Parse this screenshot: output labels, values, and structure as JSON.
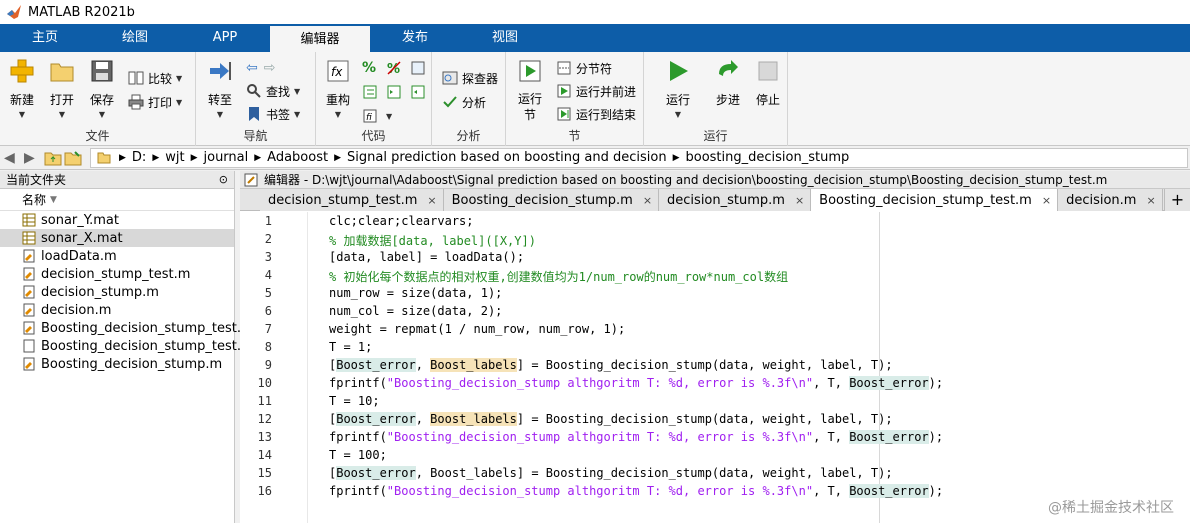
{
  "window": {
    "title": "MATLAB R2021b"
  },
  "ribbon_tabs": [
    "主页",
    "绘图",
    "APP",
    "编辑器",
    "发布",
    "视图"
  ],
  "ribbon": {
    "file": {
      "new": "新建",
      "open": "打开",
      "save": "保存",
      "compare": "比较",
      "print": "打印",
      "group": "文件"
    },
    "nav": {
      "goto": "转至",
      "find": "查找",
      "bookmark": "书签",
      "group": "导航"
    },
    "code": {
      "refactor": "重构",
      "percent": "%",
      "group": "代码"
    },
    "analyze": {
      "profiler": "探查器",
      "analyze": "分析",
      "group": "分析"
    },
    "section": {
      "run_section": "运行节",
      "section_break": "分节符",
      "run_advance": "运行并前进",
      "run_to_end": "运行到结束",
      "group": "节"
    },
    "run": {
      "run": "运行",
      "step": "步进",
      "stop": "停止",
      "group": "运行"
    }
  },
  "breadcrumb": [
    "D:",
    "wjt",
    "journal",
    "Adaboost",
    "Signal prediction based on boosting and decision",
    "boosting_decision_stump"
  ],
  "left_panel": {
    "title": "当前文件夹",
    "column": "名称",
    "files": [
      {
        "name": "sonar_Y.mat",
        "type": "mat",
        "selected": false
      },
      {
        "name": "sonar_X.mat",
        "type": "mat",
        "selected": true
      },
      {
        "name": "loadData.m",
        "type": "m",
        "selected": false
      },
      {
        "name": "decision_stump_test.m",
        "type": "m",
        "selected": false
      },
      {
        "name": "decision_stump.m",
        "type": "m",
        "selected": false
      },
      {
        "name": "decision.m",
        "type": "m",
        "selected": false
      },
      {
        "name": "Boosting_decision_stump_test.m",
        "type": "m",
        "selected": false
      },
      {
        "name": "Boosting_decision_stump_test.a...",
        "type": "doc",
        "selected": false
      },
      {
        "name": "Boosting_decision_stump.m",
        "type": "m",
        "selected": false
      }
    ]
  },
  "editor": {
    "title": "编辑器 - D:\\wjt\\journal\\Adaboost\\Signal prediction based on boosting and decision\\boosting_decision_stump\\Boosting_decision_stump_test.m",
    "tabs": [
      {
        "label": "decision_stump_test.m",
        "active": false
      },
      {
        "label": "Boosting_decision_stump.m",
        "active": false
      },
      {
        "label": "decision_stump.m",
        "active": false
      },
      {
        "label": "Boosting_decision_stump_test.m",
        "active": true
      },
      {
        "label": "decision.m",
        "active": false
      }
    ],
    "close_glyph": "×",
    "add_tab": "+",
    "lines": [
      {
        "n": "1",
        "segs": [
          [
            "",
            "clc;clear;clearvars;"
          ]
        ]
      },
      {
        "n": "2",
        "segs": [
          [
            "cm",
            "% 加载数据[data, label]([X,Y])"
          ]
        ]
      },
      {
        "n": "3",
        "segs": [
          [
            "",
            "[data, label] = loadData();"
          ]
        ]
      },
      {
        "n": "4",
        "segs": [
          [
            "cm",
            "% 初始化每个数据点的相对权重,创建数值均为1/num_row的num_row*num_col数组"
          ]
        ]
      },
      {
        "n": "5",
        "segs": [
          [
            "",
            "num_row = size(data, 1);"
          ]
        ]
      },
      {
        "n": "6",
        "segs": [
          [
            "",
            "num_col = size(data, 2);"
          ]
        ]
      },
      {
        "n": "7",
        "segs": [
          [
            "",
            "weight = repmat(1 / num_row, num_row, 1);"
          ]
        ]
      },
      {
        "n": "8",
        "segs": [
          [
            "",
            "T = 1;"
          ]
        ]
      },
      {
        "n": "9",
        "segs": [
          [
            "",
            "["
          ],
          [
            "hl-c",
            "Boost_error"
          ],
          [
            "",
            ", "
          ],
          [
            "hl-y",
            "Boost_labels"
          ],
          [
            "",
            "] = Boosting_decision_stump(data, weight, label, T);"
          ]
        ]
      },
      {
        "n": "10",
        "segs": [
          [
            "",
            "fprintf("
          ],
          [
            "str",
            "\"Boosting_decision_stump althgoritm T: %d, error is %.3f\\n\""
          ],
          [
            "",
            ", T, "
          ],
          [
            "hl-c",
            "Boost_error"
          ],
          [
            "",
            ");"
          ]
        ]
      },
      {
        "n": "11",
        "segs": [
          [
            "",
            "T = 10;"
          ]
        ]
      },
      {
        "n": "12",
        "segs": [
          [
            "",
            "["
          ],
          [
            "hl-c",
            "Boost_error"
          ],
          [
            "",
            ", "
          ],
          [
            "hl-y",
            "Boost_labels"
          ],
          [
            "",
            "] = Boosting_decision_stump(data, weight, label, T);"
          ]
        ]
      },
      {
        "n": "13",
        "segs": [
          [
            "",
            "fprintf("
          ],
          [
            "str",
            "\"Boosting_decision_stump althgoritm T: %d, error is %.3f\\n\""
          ],
          [
            "",
            ", T, "
          ],
          [
            "hl-c",
            "Boost_error"
          ],
          [
            "",
            ");"
          ]
        ]
      },
      {
        "n": "14",
        "segs": [
          [
            "",
            "T = 100;"
          ]
        ]
      },
      {
        "n": "15",
        "segs": [
          [
            "",
            "["
          ],
          [
            "hl-c",
            "Boost_error"
          ],
          [
            "",
            ", Boost_labels] = Boosting_decision_stump(data, weight, label, T);"
          ]
        ]
      },
      {
        "n": "16",
        "segs": [
          [
            "",
            "fprintf("
          ],
          [
            "str",
            "\"Boosting_decision_stump althgoritm T: %d, error is %.3f\\n\""
          ],
          [
            "",
            ", T, "
          ],
          [
            "hl-c",
            "Boost_error"
          ],
          [
            "",
            ");"
          ]
        ]
      }
    ]
  },
  "watermark": "@稀土掘金技术社区",
  "colors": {
    "ribbon_blue": "#0d5da8",
    "comment": "#228b22",
    "string": "#a020f0"
  }
}
